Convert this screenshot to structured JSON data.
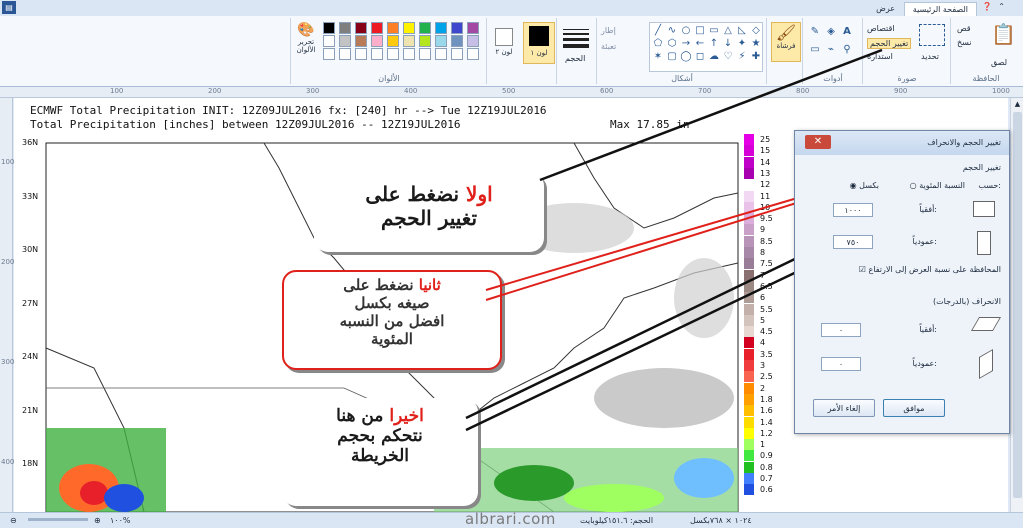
{
  "tabs": {
    "home": "الصفحة الرئيسية",
    "view": "عرض"
  },
  "ribbon": {
    "clipboard": {
      "label": "الحافظة",
      "paste": "لصق",
      "cut": "قص",
      "copy": "نسخ"
    },
    "image": {
      "label": "صورة",
      "select": "تحديد",
      "crop": "اقتصاص",
      "resize": "تغيير الحجم",
      "rotate": "استدارة"
    },
    "tools": {
      "label": "أدوات"
    },
    "brushes": {
      "label": "فرشاة"
    },
    "shapes": {
      "label": "أشكال",
      "outline": "إطار",
      "fill": "تعبئة"
    },
    "size": {
      "label": "الحجم"
    },
    "color1": {
      "label": "لون ١"
    },
    "color2": {
      "label": "لون ٢"
    },
    "colors": {
      "label": "الألوان",
      "edit": "تحرير الألوان"
    },
    "palette": [
      "#000000",
      "#7f7f7f",
      "#880015",
      "#ed1c24",
      "#ff7f27",
      "#fff200",
      "#22b14c",
      "#00a2e8",
      "#3f48cc",
      "#a349a4",
      "#ffffff",
      "#c3c3c3",
      "#b97a57",
      "#ffaec9",
      "#ffc90e",
      "#efe4b0",
      "#b5e61d",
      "#99d9ea",
      "#7092be",
      "#c8bfe7"
    ]
  },
  "chart": {
    "title": "ECMWF Total Precipitation INIT: 12Z09JUL2016 fx: [240] hr --> Tue 12Z19JUL2016",
    "subtitle": "Total Precipitation [inches] between 12Z09JUL2016 -- 12Z19JUL2016",
    "max_label": "Max 17.85 in",
    "lat_labels": [
      "36N",
      "33N",
      "30N",
      "27N",
      "24N",
      "21N",
      "18N"
    ],
    "legend_values": [
      "25",
      "15",
      "14",
      "13",
      "12",
      "11",
      "10",
      "9.5",
      "9",
      "8.5",
      "8",
      "7.5",
      "7",
      "6.5",
      "6",
      "5.5",
      "5",
      "4.5",
      "4",
      "3.5",
      "3",
      "2.5",
      "2",
      "1.8",
      "1.6",
      "1.4",
      "1.2",
      "1",
      "0.9",
      "0.8",
      "0.7",
      "0.6"
    ],
    "legend_colors": [
      "#e600e6",
      "#d600d6",
      "#c000c8",
      "#a800b0",
      "#ffffff",
      "#f2d8f2",
      "#e8c2e8",
      "#dcaedc",
      "#c8a0c8",
      "#b894b8",
      "#a888a8",
      "#987c98",
      "#8a7070",
      "#9e8a84",
      "#b09c96",
      "#c4b0aa",
      "#d4c4be",
      "#e8d8d2",
      "#d2001e",
      "#e8202a",
      "#f03c3c",
      "#f86450",
      "#ff8c00",
      "#ffa000",
      "#ffbe00",
      "#ffdc00",
      "#ffff00",
      "#a0ff60",
      "#40e840",
      "#20c020",
      "#4080ff",
      "#2050e0"
    ]
  },
  "callouts": {
    "first_a": "اولا",
    "first_b": "نضغط على",
    "first_c": "تغيير الحجم",
    "second_a": "ثانيا",
    "second_b": "نضغط على",
    "second_c": "صيغه بكسل",
    "second_d": "افضل من النسبه",
    "second_e": "المئوية",
    "third_a": "اخيرا",
    "third_b": "من هنا",
    "third_c": "نتحكم بحجم",
    "third_d": "الخريطة"
  },
  "dialog": {
    "title": "تغيير الحجم والانحراف",
    "resize_section": "تغيير الحجم",
    "by": "حسب:",
    "percent": "النسبة المئوية",
    "pixels": "بكسل",
    "horizontal": "أفقياً:",
    "vertical": "عمودياً:",
    "width_value": "١٠٠٠",
    "height_value": "٧٥٠",
    "keep_ratio": "المحافظة على نسبة العرض إلى الارتفاع",
    "skew_section": "الانحراف (بالدرجات)",
    "skew_h_label": "أفقياً:",
    "skew_v_label": "عمودياً:",
    "skew_h": "٠",
    "skew_v": "٠",
    "ok": "موافق",
    "cancel": "إلغاء الأمر"
  },
  "status": {
    "dimensions": "١٠٢٤ × ٧٦٨بكسل",
    "filesize": "الحجم: ١٥١.٦كيلوبايت",
    "zoom": "١٠٠%"
  },
  "watermark": "albrari.com",
  "ruler_marks": [
    "100",
    "200",
    "300",
    "400",
    "500",
    "600",
    "700",
    "800",
    "900",
    "1000"
  ]
}
